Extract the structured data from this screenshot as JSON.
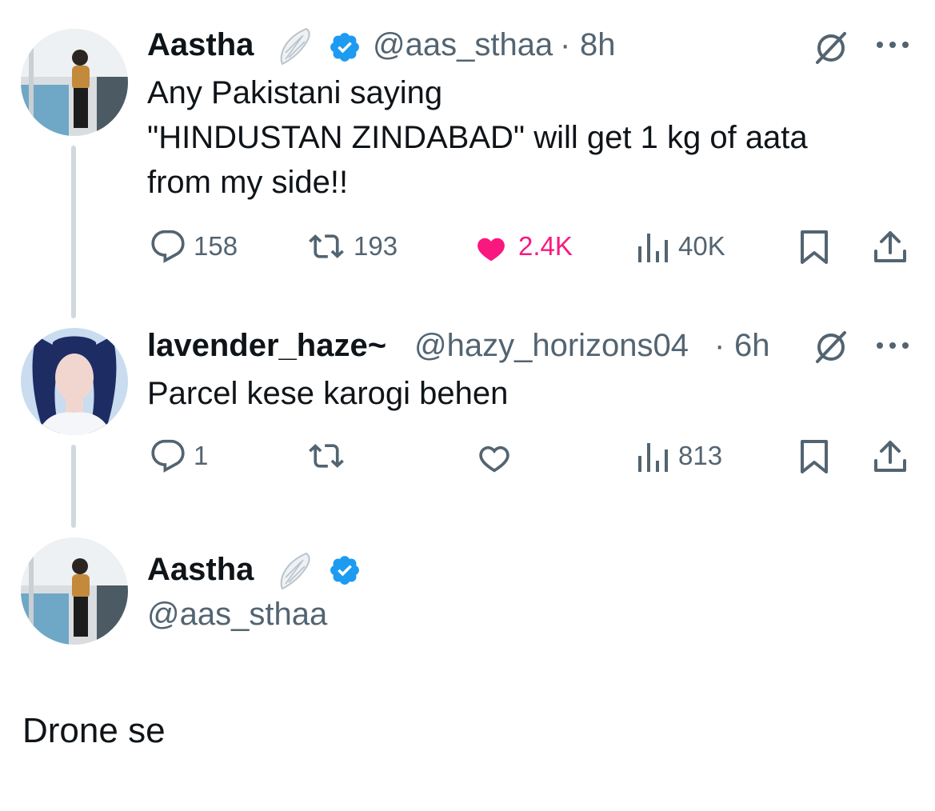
{
  "colors": {
    "text": "#0f1419",
    "secondary": "#536471",
    "like": "#f91880",
    "verified": "#1d9bf0",
    "thread_line": "#cfd9de"
  },
  "tweets": [
    {
      "name": "Aastha",
      "handle": "@aas_sthaa",
      "separator": "·",
      "time": "8h",
      "lines": [
        "Any Pakistani saying",
        "\"HINDUSTAN ZINDABAD\" will get 1 kg of aata",
        "from my side!!"
      ],
      "replies": "158",
      "reposts": "193",
      "likes": "2.4K",
      "liked": true,
      "views": "40K"
    },
    {
      "name": "lavender_haze~",
      "handle": "@hazy_horizons04",
      "separator": "·",
      "time": "6h",
      "lines": [
        "Parcel kese karogi behen"
      ],
      "replies": "1",
      "reposts": "",
      "likes": "",
      "liked": false,
      "views": "813"
    }
  ],
  "main_tweet": {
    "name": "Aastha",
    "handle": "@aas_sthaa",
    "text": "Drone se"
  },
  "icons": [
    "wing-emoji-icon",
    "verified-badge-icon",
    "grok-icon",
    "more-icon",
    "reply-icon",
    "repost-icon",
    "like-icon",
    "views-icon",
    "bookmark-icon",
    "share-icon"
  ]
}
